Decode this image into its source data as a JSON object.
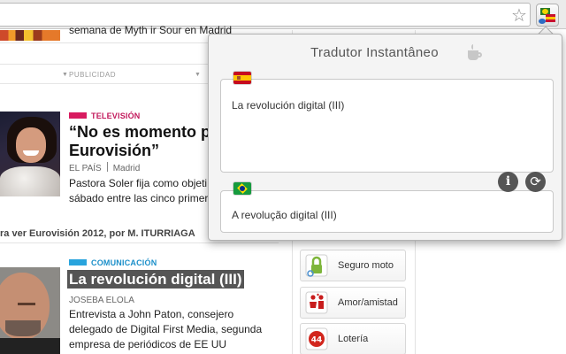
{
  "browser": {
    "star_glyph": "☆",
    "extension_name": "Tradutor Instantâneo"
  },
  "page": {
    "top_text": "semana de Myth ir Sour en Madrid",
    "ad_label": "PUBLICIDAD",
    "articles": [
      {
        "category": "TELEVISIÓN",
        "category_color": "#d81b60",
        "headline_line1": "“No es momento par",
        "headline_line2": "Eurovisión”",
        "source": "EL PAÍS",
        "location": "Madrid",
        "summary_line1": "Pastora Soler fija como objeti",
        "summary_line2": "sábado entre las cinco primer"
      },
      {
        "category": "COMUNICACIÓN",
        "category_color": "#29a4dd",
        "headline": "La revolución digital (III)",
        "author": "JOSEBA ELOLA",
        "summary_line1": "Entrevista a John Paton, consejero",
        "summary_line2": "delegado de Digital First Media, segunda",
        "summary_line3": "empresa de periódicos de EE UU"
      }
    ],
    "related_text": "ra ver Eurovisión 2012, por M. ITURRIAGA",
    "sidebar": [
      {
        "label": "Seguro moto",
        "icon": "lock-icon"
      },
      {
        "label": "Amor/amistad",
        "icon": "couple-icon"
      },
      {
        "label": "Lotería",
        "icon": "lottery-ball-icon"
      }
    ]
  },
  "popup": {
    "title": "Tradutor Instantâneo",
    "source_lang_icon": "spain-flag-icon",
    "source_text": "La revolución digital (III)",
    "target_lang_icon": "brazil-flag-icon",
    "target_text": "A revolução digital (III)",
    "info_glyph": "i",
    "refresh_glyph": "⟳"
  }
}
